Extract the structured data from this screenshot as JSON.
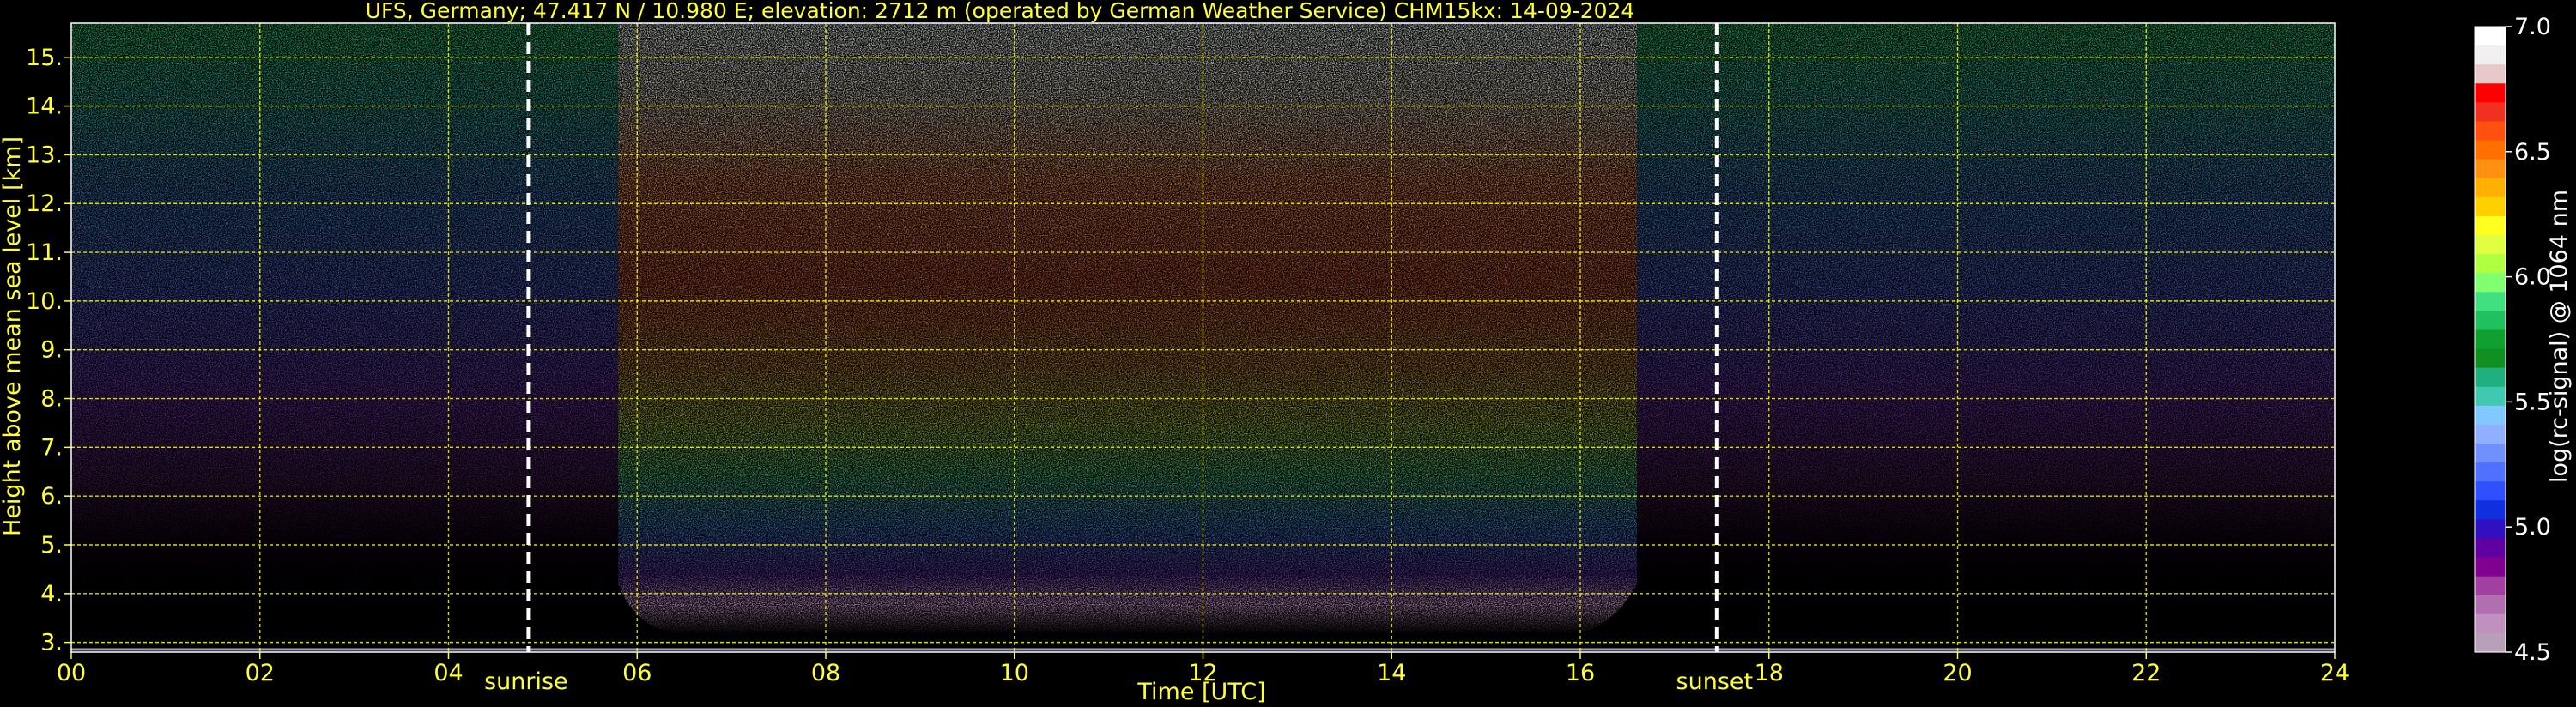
{
  "chart_data": {
    "type": "heatmap",
    "title": "UFS, Germany; 47.417 N / 10.980 E; elevation: 2712 m  (operated by German Weather Service)    CHM15kx: 14-09-2024",
    "xlabel": "Time [UTC]",
    "ylabel": "Height above mean sea level [km]",
    "xlim": [
      0,
      24
    ],
    "ylim": [
      2.8,
      15.7
    ],
    "x_ticks": [
      "00",
      "02",
      "04",
      "06",
      "08",
      "10",
      "12",
      "14",
      "16",
      "18",
      "20",
      "22",
      "24"
    ],
    "y_ticks": [
      "3.",
      "4.",
      "5.",
      "6.",
      "7.",
      "8.",
      "9.",
      "10.",
      "11.",
      "12.",
      "13.",
      "14.",
      "15."
    ],
    "grid": true,
    "annotations": [
      {
        "label": "sunrise",
        "x": 4.85
      },
      {
        "label": "sunset",
        "x": 17.45
      }
    ],
    "colorbar": {
      "label": "log(rc-signal) @ 1064 nm",
      "range": [
        4.5,
        7.0
      ],
      "ticks": [
        "7.0",
        "6.5",
        "6.0",
        "5.5",
        "5.0",
        "4.5"
      ],
      "colors": [
        "#ffffff",
        "#f0f0f0",
        "#e8c8c8",
        "#ff0000",
        "#f03020",
        "#ff5010",
        "#ff7000",
        "#ff9010",
        "#ffb000",
        "#ffd000",
        "#ffff20",
        "#e0ff40",
        "#b0ff40",
        "#80ff70",
        "#40e080",
        "#20c060",
        "#10a030",
        "#109020",
        "#20b080",
        "#40c8b0",
        "#80c8ff",
        "#90b0ff",
        "#7090ff",
        "#5070ff",
        "#3050ff",
        "#1030e0",
        "#3010c0",
        "#6000a0",
        "#800090",
        "#a040a0",
        "#b070b0",
        "#c090c0",
        "#b8a0b8"
      ]
    }
  }
}
